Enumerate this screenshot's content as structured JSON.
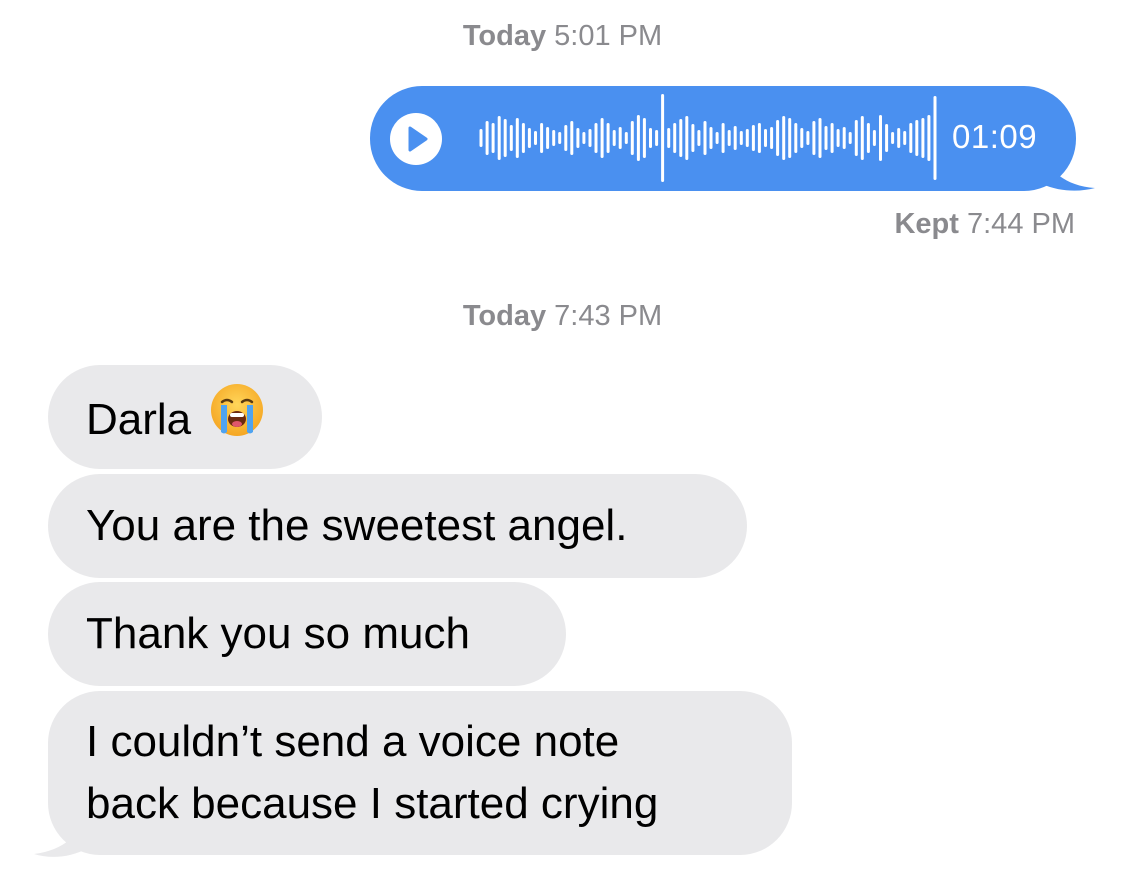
{
  "timestamps": [
    {
      "day": "Today",
      "time": "5:01 PM"
    },
    {
      "day": "Today",
      "time": "7:43 PM"
    }
  ],
  "voice_message": {
    "duration": "01:09",
    "delivery_status": "Kept",
    "delivery_time": "7:44 PM"
  },
  "incoming_messages": [
    {
      "text": "Darla",
      "emoji": "loudly-crying-face"
    },
    {
      "text": "You are the sweetest angel."
    },
    {
      "text": "Thank you so much"
    },
    {
      "lines": [
        "I couldn’t send a voice note",
        "back because I started crying"
      ]
    }
  ],
  "colors": {
    "outgoing_bubble": "#4a90f0",
    "incoming_bubble": "#e9e9eb",
    "timestamp_text": "#8a8a8e"
  }
}
